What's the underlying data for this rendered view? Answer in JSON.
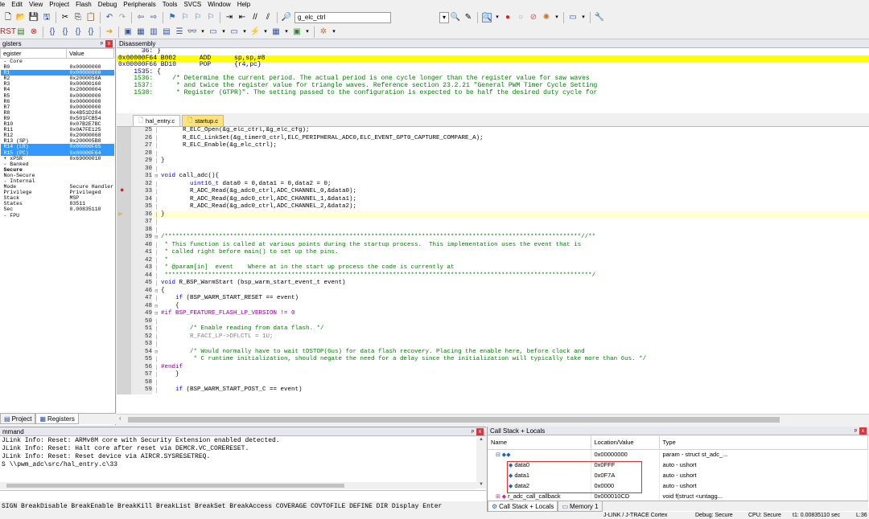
{
  "menu": [
    "le",
    "Edit",
    "View",
    "Project",
    "Flash",
    "Debug",
    "Peripherals",
    "Tools",
    "SVCS",
    "Window",
    "Help"
  ],
  "toolbar": {
    "target_combo": "g_elc_ctrl"
  },
  "registers": {
    "title": "gisters",
    "col_register": "egister",
    "col_value": "Value",
    "rows": [
      {
        "name": "- Core",
        "value": "",
        "sel": false
      },
      {
        "name": "  R0",
        "value": "0x00000000",
        "sel": false
      },
      {
        "name": "  R1",
        "value": "0x00000000",
        "sel": true
      },
      {
        "name": "  R2",
        "value": "0x2000058A",
        "sel": false
      },
      {
        "name": "  R3",
        "value": "0x00000160",
        "sel": false
      },
      {
        "name": "  R4",
        "value": "0x20000004",
        "sel": false
      },
      {
        "name": "  R5",
        "value": "0x00000000",
        "sel": false
      },
      {
        "name": "  R6",
        "value": "0x00000000",
        "sel": false
      },
      {
        "name": "  R7",
        "value": "0x00000000",
        "sel": false
      },
      {
        "name": "  R8",
        "value": "0x4B51D284",
        "sel": false
      },
      {
        "name": "  R9",
        "value": "0x501FCB54",
        "sel": false
      },
      {
        "name": "  R10",
        "value": "0x07B2E7BC",
        "sel": false
      },
      {
        "name": "  R11",
        "value": "0x0A7FE125",
        "sel": false
      },
      {
        "name": "  R12",
        "value": "0x20000068",
        "sel": false
      },
      {
        "name": "  R13 (SP)",
        "value": "0x200005B8",
        "sel": false
      },
      {
        "name": "  R14 (LR)",
        "value": "0x00000F65",
        "sel": true
      },
      {
        "name": "  R15 (PC)",
        "value": "0x00000F64",
        "sel": true
      },
      {
        "name": "+ xPSR",
        "value": "0x69000010",
        "sel": false
      },
      {
        "name": "- Banked",
        "value": "",
        "sel": false
      },
      {
        "name": "  Secure",
        "value": "",
        "sel": false
      },
      {
        "name": "  Non-Secure",
        "value": "",
        "sel": false
      },
      {
        "name": "- Internal",
        "value": "",
        "sel": false
      },
      {
        "name": "    Mode",
        "value": "Secure Handler",
        "sel": false
      },
      {
        "name": "    Privilege",
        "value": "Privileged",
        "sel": false
      },
      {
        "name": "    Stack",
        "value": "MSP",
        "sel": false
      },
      {
        "name": "    States",
        "value": "83511",
        "sel": false
      },
      {
        "name": "    Sec",
        "value": "0.00835110",
        "sel": false
      },
      {
        "name": "- FPU",
        "value": "",
        "sel": false
      }
    ],
    "tab_project": "Project",
    "tab_registers": "Registers"
  },
  "disassembly": {
    "title": "Disassembly",
    "lines": [
      {
        "text": "      36: }",
        "hl": false,
        "cls": ""
      },
      {
        "text": "0x00000F64 B002      ADD      sp,sp,#8",
        "hl": true,
        "cls": ""
      },
      {
        "text": "0x00000F66 BD10      POP      {r4,pc}",
        "hl": false,
        "cls": ""
      },
      {
        "text": "    1535: {",
        "hl": false,
        "cls": ""
      },
      {
        "text": "    1536:     /* Determine the current period. The actual period is one cycle longer than the register value for saw waves",
        "hl": false,
        "cls": "c"
      },
      {
        "text": "    1537:      * and twice the register value for triangle waves. Reference section 23.2.21 \"General PWM Timer Cycle Setting",
        "hl": false,
        "cls": "c"
      },
      {
        "text": "    1538:      * Register (GTPR)\". The setting passed to the configuration is expected to be half the desired duty cycle for",
        "hl": false,
        "cls": "c"
      }
    ]
  },
  "editor": {
    "tabs": [
      "hal_entry.c",
      "startup.c"
    ],
    "lines": [
      {
        "n": "25",
        "code": "      R_ELC_Open(&g_elc_ctrl,&g_elc_cfg);",
        "cls": "",
        "fold": "",
        "mark": ""
      },
      {
        "n": "26",
        "code": "      R_ELC_LinkSet(&g_timer0_ctrl,ELC_PERIPHERAL_ADC0,ELC_EVENT_GPT0_CAPTURE_COMPARE_A);",
        "cls": "",
        "fold": "",
        "mark": ""
      },
      {
        "n": "27",
        "code": "      R_ELC_Enable(&g_elc_ctrl);",
        "cls": "",
        "fold": "",
        "mark": ""
      },
      {
        "n": "28",
        "code": "",
        "cls": "",
        "fold": "",
        "mark": ""
      },
      {
        "n": "29",
        "code": "}",
        "cls": "",
        "fold": "",
        "mark": ""
      },
      {
        "n": "30",
        "code": "",
        "cls": "",
        "fold": "",
        "mark": ""
      },
      {
        "n": "31",
        "code": "void call_adc(){",
        "cls": "",
        "fold": "-",
        "mark": ""
      },
      {
        "n": "32",
        "code": "        uint16_t data0 = 0,data1 = 0,data2 = 0;",
        "cls": "",
        "fold": "",
        "mark": ""
      },
      {
        "n": "33",
        "code": "        R_ADC_Read(&g_adc0_ctrl,ADC_CHANNEL_0,&data0);",
        "cls": "",
        "fold": "",
        "mark": "bp"
      },
      {
        "n": "34",
        "code": "        R_ADC_Read(&g_adc0_ctrl,ADC_CHANNEL_1,&data1);",
        "cls": "",
        "fold": "",
        "mark": ""
      },
      {
        "n": "35",
        "code": "        R_ADC_Read(&g_adc0_ctrl,ADC_CHANNEL_2,&data2);",
        "cls": "",
        "fold": "",
        "mark": ""
      },
      {
        "n": "36",
        "code": "}",
        "cls": "cur",
        "fold": "",
        "mark": "arrow"
      },
      {
        "n": "37",
        "code": "",
        "cls": "",
        "fold": "",
        "mark": ""
      },
      {
        "n": "38",
        "code": "",
        "cls": "",
        "fold": "",
        "mark": ""
      },
      {
        "n": "39",
        "code": "/*******************************************************************************************************************//**",
        "cls": "cm",
        "fold": "-",
        "mark": ""
      },
      {
        "n": "40",
        "code": " * This function is called at various points during the startup process.  This implementation uses the event that is",
        "cls": "cm",
        "fold": "",
        "mark": ""
      },
      {
        "n": "41",
        "code": " * called right before main() to set up the pins.",
        "cls": "cm",
        "fold": "",
        "mark": ""
      },
      {
        "n": "42",
        "code": " *",
        "cls": "cm",
        "fold": "",
        "mark": ""
      },
      {
        "n": "43",
        "code": " * @param[in]  event    Where at in the start up process the code is currently at",
        "cls": "cm",
        "fold": "",
        "mark": ""
      },
      {
        "n": "44",
        "code": " **********************************************************************************************************************/",
        "cls": "cm",
        "fold": "",
        "mark": ""
      },
      {
        "n": "45",
        "code": "void R_BSP_WarmStart (bsp_warm_start_event_t event)",
        "cls": "",
        "fold": "",
        "mark": ""
      },
      {
        "n": "46",
        "code": "{",
        "cls": "",
        "fold": "-",
        "mark": ""
      },
      {
        "n": "47",
        "code": "    if (BSP_WARM_START_RESET == event)",
        "cls": "",
        "fold": "",
        "mark": ""
      },
      {
        "n": "48",
        "code": "    {",
        "cls": "",
        "fold": "-",
        "mark": ""
      },
      {
        "n": "49",
        "code": "#if BSP_FEATURE_FLASH_LP_VERSION != 0",
        "cls": "pp",
        "fold": "-",
        "mark": ""
      },
      {
        "n": "50",
        "code": "",
        "cls": "",
        "fold": "",
        "mark": ""
      },
      {
        "n": "51",
        "code": "        /* Enable reading from data flash. */",
        "cls": "cm",
        "fold": "",
        "mark": ""
      },
      {
        "n": "52",
        "code": "        R_FACI_LP->DFLCTL = 1U;",
        "cls": "dead",
        "fold": "",
        "mark": ""
      },
      {
        "n": "53",
        "code": "",
        "cls": "",
        "fold": "",
        "mark": ""
      },
      {
        "n": "54",
        "code": "        /* Would normally have to wait tDSTOP(6us) for data flash recovery. Placing the enable here, before clock and",
        "cls": "cm",
        "fold": "-",
        "mark": ""
      },
      {
        "n": "55",
        "code": "         * C runtime initialization, should negate the need for a delay since the initialization will typically take more than 6us. */",
        "cls": "cm",
        "fold": "",
        "mark": ""
      },
      {
        "n": "56",
        "code": "#endif",
        "cls": "pp",
        "fold": "",
        "mark": ""
      },
      {
        "n": "57",
        "code": "    }",
        "cls": "",
        "fold": "",
        "mark": ""
      },
      {
        "n": "58",
        "code": "",
        "cls": "",
        "fold": "",
        "mark": ""
      },
      {
        "n": "59",
        "code": "    if (BSP_WARM_START_POST_C == event)",
        "cls": "",
        "fold": "",
        "mark": ""
      }
    ]
  },
  "command": {
    "title": "mmand",
    "lines": [
      "JLink Info: Reset: ARMv8M core with Security Extension enabled detected.",
      "JLink Info: Reset: Halt core after reset via DEMCR.VC_CORERESET.",
      "JLink Info: Reset: Reset device via AIRCR.SYSRESETREQ.",
      "S \\\\pwm_adc\\src/hal_entry.c\\33"
    ],
    "hints": "SIGN BreakDisable BreakEnable BreakKill BreakList BreakSet BreakAccess COVERAGE COVTOFILE DEFINE DIR Display Enter"
  },
  "callstack": {
    "title": "Call Stack + Locals",
    "col_name": "Name",
    "col_location": "Location/Value",
    "col_type": "Type",
    "rows": [
      {
        "name": "",
        "loc": "0x00000000",
        "type": "param - struct st_adc_..."
      },
      {
        "name": "data0",
        "loc": "0x0FFF",
        "type": "auto - ushort"
      },
      {
        "name": "data1",
        "loc": "0x0F7A",
        "type": "auto - ushort"
      },
      {
        "name": "data2",
        "loc": "0x0000",
        "type": "auto - ushort"
      },
      {
        "name": "r_adc_call_callback",
        "loc": "0x000010CD",
        "type": "void f(struct <untagg..."
      }
    ],
    "tab_callstack": "Call Stack + Locals",
    "tab_memory": "Memory 1"
  },
  "status": {
    "debugger": "J-LINK / J-TRACE Cortex",
    "debug_mode": "Debug: Secure",
    "cpu_mode": "CPU: Secure",
    "time": "t1: 0.00835110 sec",
    "line": "L:36"
  }
}
